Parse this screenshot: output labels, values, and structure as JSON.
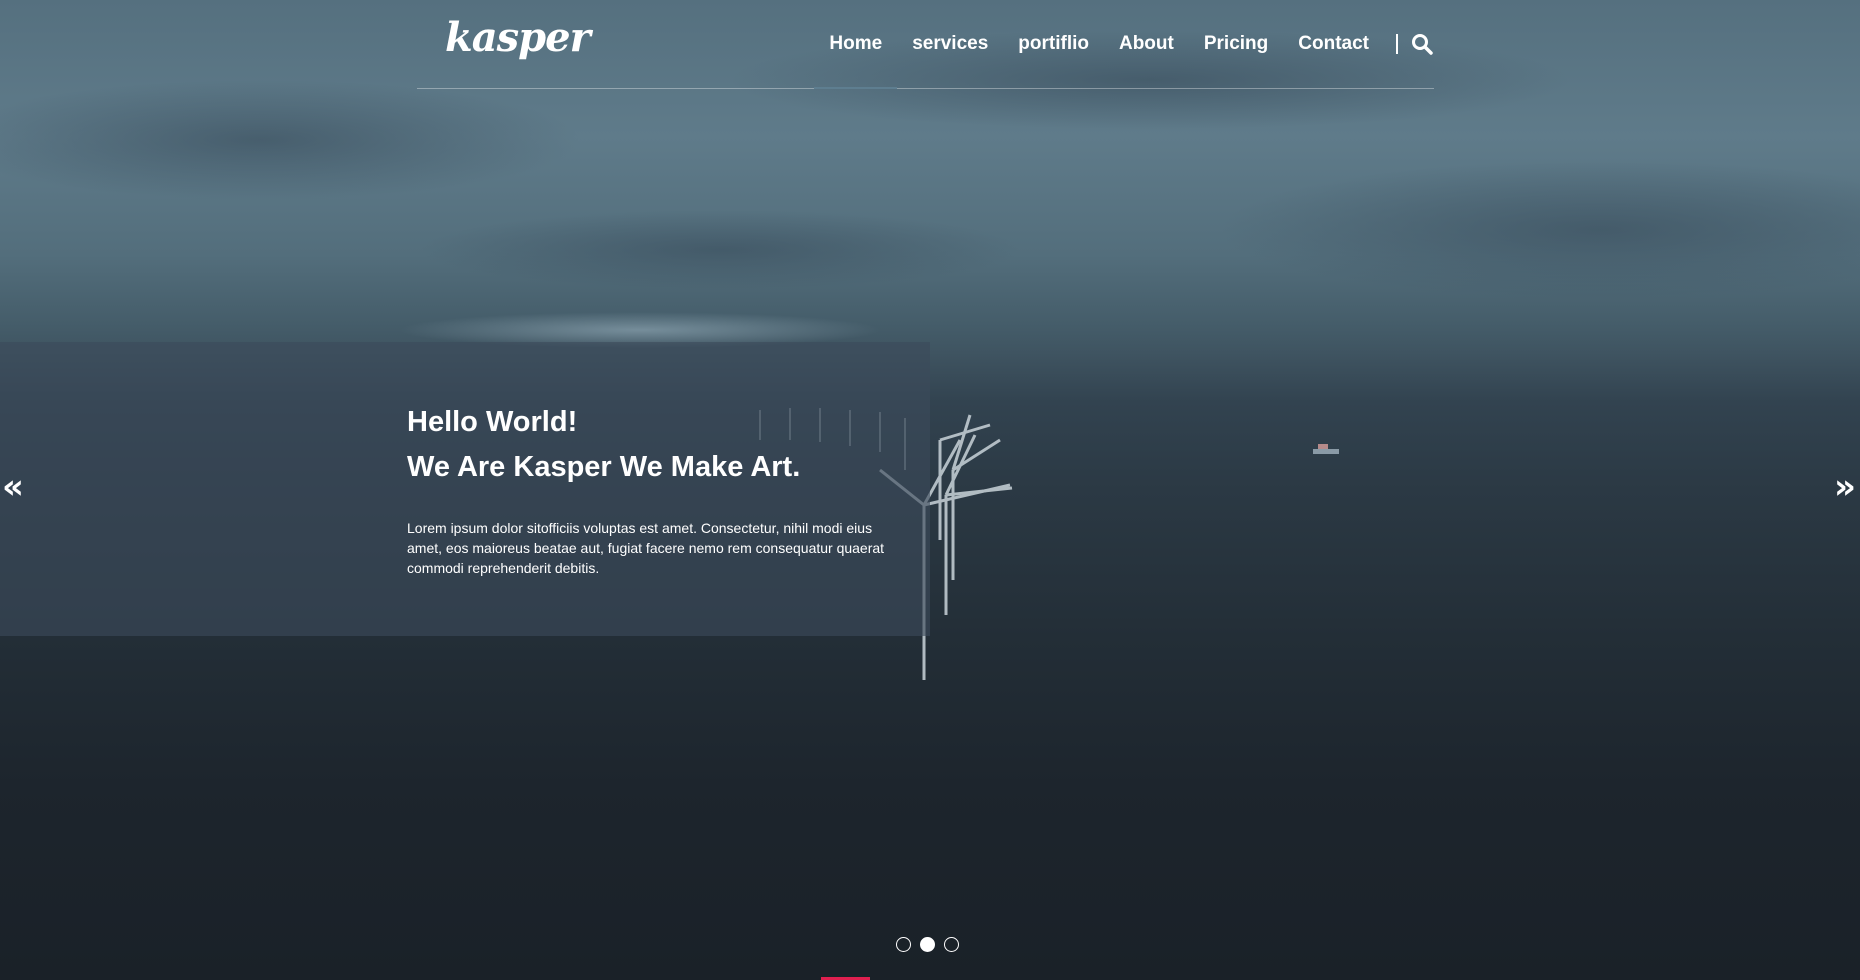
{
  "header": {
    "logo_text": "kasper",
    "nav": [
      {
        "label": "Home",
        "active": true
      },
      {
        "label": "services",
        "active": false
      },
      {
        "label": "portiflio",
        "active": false
      },
      {
        "label": "About",
        "active": false
      },
      {
        "label": "Pricing",
        "active": false
      },
      {
        "label": "Contact",
        "active": false
      }
    ],
    "search_icon": "search-icon"
  },
  "hero": {
    "title_line1": "Hello World!",
    "title_line2": "We Are Kasper We Make Art.",
    "text": "Lorem ipsum dolor sitofficiis voluptas est amet. Consectetur, nihil modi eius amet, eos maioreus beatae aut, fugiat facere nemo rem consequatur quaerat commodi reprehenderit debitis."
  },
  "slider": {
    "prev_icon": "«",
    "next_icon": "»",
    "bullets": 3,
    "active_bullet": 2
  },
  "colors": {
    "accent": "#e01f4f",
    "sky": "#5f7b8a",
    "sea": "#1d252d"
  }
}
